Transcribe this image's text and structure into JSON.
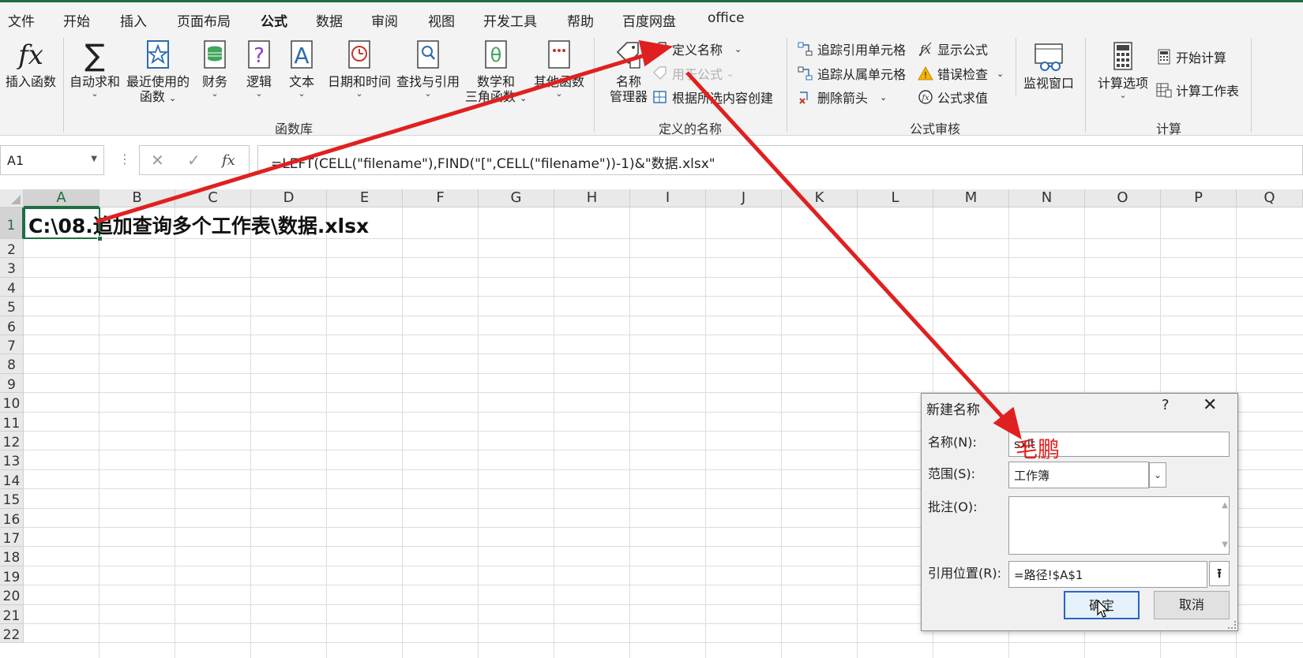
{
  "menu": {
    "tabs": [
      "文件",
      "开始",
      "插入",
      "页面布局",
      "公式",
      "数据",
      "审阅",
      "视图",
      "开发工具",
      "帮助",
      "百度网盘",
      "office"
    ],
    "active": "公式"
  },
  "ribbon": {
    "function_library": {
      "insert_function": "插入函数",
      "autosum": "自动求和",
      "recent_line1": "最近使用的",
      "recent_line2": "函数",
      "financial": "财务",
      "logical": "逻辑",
      "text": "文本",
      "datetime": "日期和时间",
      "lookup": "查找与引用",
      "math_line1": "数学和",
      "math_line2": "三角函数",
      "other": "其他函数",
      "group_label": "函数库"
    },
    "defined_names": {
      "name_manager_line1": "名称",
      "name_manager_line2": "管理器",
      "define_name": "定义名称",
      "use_in_formula": "用于公式",
      "create_from_selection": "根据所选内容创建",
      "group_label": "定义的名称"
    },
    "formula_auditing": {
      "trace_precedents": "追踪引用单元格",
      "trace_dependents": "追踪从属单元格",
      "remove_arrows": "删除箭头",
      "show_formulas": "显示公式",
      "error_checking": "错误检查",
      "evaluate_formula": "公式求值",
      "watch_window": "监视窗口",
      "group_label": "公式审核"
    },
    "calculation": {
      "calc_options": "计算选项",
      "calc_now": "开始计算",
      "calc_sheet": "计算工作表",
      "group_label": "计算"
    }
  },
  "formula_bar": {
    "name_box": "A1",
    "formula": "=LEFT(CELL(\"filename\"),FIND(\"[\",CELL(\"filename\"))-1)&\"数据.xlsx\""
  },
  "sheet": {
    "columns": [
      "A",
      "B",
      "C",
      "D",
      "E",
      "F",
      "G",
      "H",
      "I",
      "J",
      "K",
      "L",
      "M",
      "N",
      "O",
      "P",
      "Q"
    ],
    "rows": [
      "1",
      "2",
      "3",
      "4",
      "5",
      "6",
      "7",
      "8",
      "9",
      "10",
      "11",
      "12",
      "13",
      "14",
      "15",
      "16",
      "17",
      "18",
      "19",
      "20",
      "21",
      "22"
    ],
    "a1_value": "C:\\08.追加查询多个工作表\\数据.xlsx"
  },
  "dialog": {
    "title": "新建名称",
    "help": "?",
    "close": "✕",
    "name_label": "名称(N):",
    "name_value": "sxlt",
    "scope_label": "范围(S):",
    "scope_value": "工作簿",
    "comment_label": "批注(O):",
    "comment_value": "",
    "refers_label": "引用位置(R):",
    "refers_value": "=路径!$A$1",
    "ok": "确定",
    "cancel": "取消"
  },
  "annotation": {
    "text": "毛鹏",
    "color": "#e02020"
  }
}
